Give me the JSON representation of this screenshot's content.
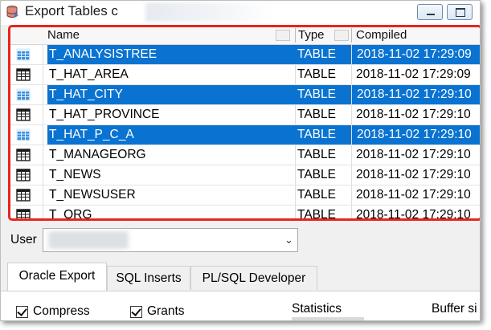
{
  "window": {
    "title": "Export Tables c",
    "app_icon": "database-export-icon"
  },
  "table": {
    "columns": [
      "Name",
      "Type",
      "Compiled"
    ],
    "rows": [
      {
        "name": "T_ANALYSISTREE",
        "type": "TABLE",
        "compiled": "2018-11-02 17:29:09",
        "selected": true
      },
      {
        "name": "T_HAT_AREA",
        "type": "TABLE",
        "compiled": "2018-11-02 17:29:09",
        "selected": false
      },
      {
        "name": "T_HAT_CITY",
        "type": "TABLE",
        "compiled": "2018-11-02 17:29:10",
        "selected": true
      },
      {
        "name": "T_HAT_PROVINCE",
        "type": "TABLE",
        "compiled": "2018-11-02 17:29:10",
        "selected": false
      },
      {
        "name": "T_HAT_P_C_A",
        "type": "TABLE",
        "compiled": "2018-11-02 17:29:10",
        "selected": true
      },
      {
        "name": "T_MANAGEORG",
        "type": "TABLE",
        "compiled": "2018-11-02 17:29:10",
        "selected": false
      },
      {
        "name": "T_NEWS",
        "type": "TABLE",
        "compiled": "2018-11-02 17:29:10",
        "selected": false
      },
      {
        "name": "T_NEWSUSER",
        "type": "TABLE",
        "compiled": "2018-11-02 17:29:10",
        "selected": false
      },
      {
        "name": "T_ORG",
        "type": "TABLE",
        "compiled": "2018-11-02 17:29:10",
        "selected": false
      }
    ]
  },
  "user": {
    "label": "User",
    "value": ""
  },
  "tabs": [
    {
      "label": "Oracle Export",
      "active": true
    },
    {
      "label": "SQL Inserts",
      "active": false
    },
    {
      "label": "PL/SQL Developer",
      "active": false
    }
  ],
  "options": {
    "compress_label": "Compress",
    "compress_checked": true,
    "grants_label": "Grants",
    "grants_checked": true,
    "statistics_label": "Statistics",
    "buffer_label": "Buffer si"
  },
  "colors": {
    "selection": "#0a73d1",
    "highlight_outline": "#e8241f"
  }
}
